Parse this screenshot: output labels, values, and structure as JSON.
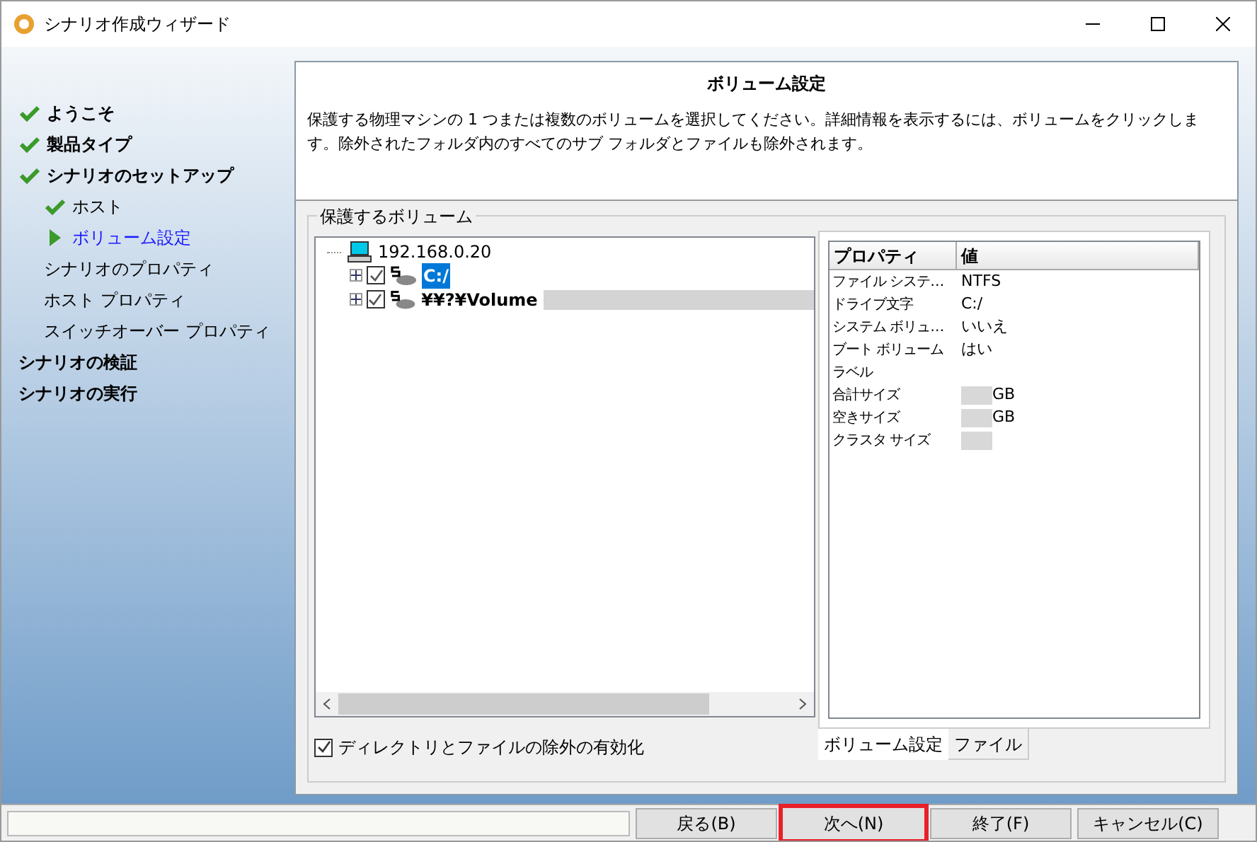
{
  "window": {
    "title": "シナリオ作成ウィザード"
  },
  "steps": [
    {
      "label": "ようこそ",
      "kind": "done"
    },
    {
      "label": "製品タイプ",
      "kind": "done"
    },
    {
      "label": "シナリオのセットアップ",
      "kind": "done",
      "children": [
        {
          "label": "ホスト",
          "kind": "done"
        },
        {
          "label": "ボリューム設定",
          "kind": "current"
        },
        {
          "label": "シナリオのプロパティ",
          "kind": "pending"
        },
        {
          "label": "ホスト プロパティ",
          "kind": "pending"
        },
        {
          "label": "スイッチオーバー プロパティ",
          "kind": "pending"
        }
      ]
    },
    {
      "label": "シナリオの検証",
      "kind": "pending"
    },
    {
      "label": "シナリオの実行",
      "kind": "pending"
    }
  ],
  "header": {
    "title": "ボリューム設定",
    "description": "保護する物理マシンの 1 つまたは複数のボリュームを選択してください。詳細情報を表示するには、ボリュームをクリックします。除外されたフォルダ内のすべてのサブ フォルダとファイルも除外されます。"
  },
  "volumes_group": {
    "title": "保護するボリューム",
    "tree": {
      "label": "192.168.0.20",
      "children": [
        {
          "label": "C:/",
          "checked": true,
          "selected": true,
          "redacted": false
        },
        {
          "label": "¥¥?¥Volume",
          "checked": true,
          "selected": false,
          "redacted": true
        }
      ]
    },
    "exclude_checkbox": {
      "label": "ディレクトリとファイルの除外の有効化",
      "checked": true
    }
  },
  "properties": {
    "columns": [
      "プロパティ",
      "値"
    ],
    "rows": [
      {
        "name": "ファイル システ…",
        "value": "NTFS",
        "redacted": false
      },
      {
        "name": "ドライブ文字",
        "value": "C:/",
        "redacted": false
      },
      {
        "name": "システム ボリュ…",
        "value": "いいえ",
        "redacted": false
      },
      {
        "name": "ブート ボリューム",
        "value": "はい",
        "redacted": false
      },
      {
        "name": "ラベル",
        "redacted": false
      },
      {
        "name": "合計サイズ",
        "value": "GB",
        "redacted": true
      },
      {
        "name": "空きサイズ",
        "value": "GB",
        "redacted": true
      },
      {
        "name": "クラスタ サイズ",
        "redacted": true
      }
    ],
    "tabs": [
      {
        "label": "ボリューム設定",
        "selected": true
      },
      {
        "label": "ファイル",
        "selected": false
      }
    ]
  },
  "buttons": [
    {
      "label": "戻る(B)",
      "highlighted": false
    },
    {
      "label": "次へ(N)",
      "highlighted": true
    },
    {
      "label": "終了(F)",
      "highlighted": false
    },
    {
      "label": "キャンセル(C)",
      "highlighted": false
    }
  ]
}
